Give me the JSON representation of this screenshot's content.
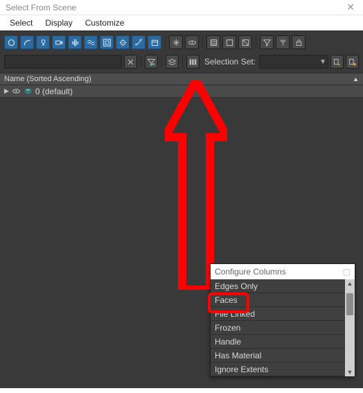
{
  "window": {
    "title": "Select From Scene"
  },
  "menu": {
    "select": "Select",
    "display": "Display",
    "customize": "Customize"
  },
  "toolbar2": {
    "selection_set_label": "Selection Set:"
  },
  "header": {
    "name_col": "Name (Sorted Ascending)"
  },
  "tree": {
    "item0": "0 (default)"
  },
  "popup": {
    "title": "Configure Columns",
    "items": {
      "edges_only": "Edges Only",
      "faces": "Faces",
      "file_linked": "File Linked",
      "frozen": "Frozen",
      "handle": "Handle",
      "has_material": "Has Material",
      "ignore_extents": "Ignore Extents"
    }
  }
}
